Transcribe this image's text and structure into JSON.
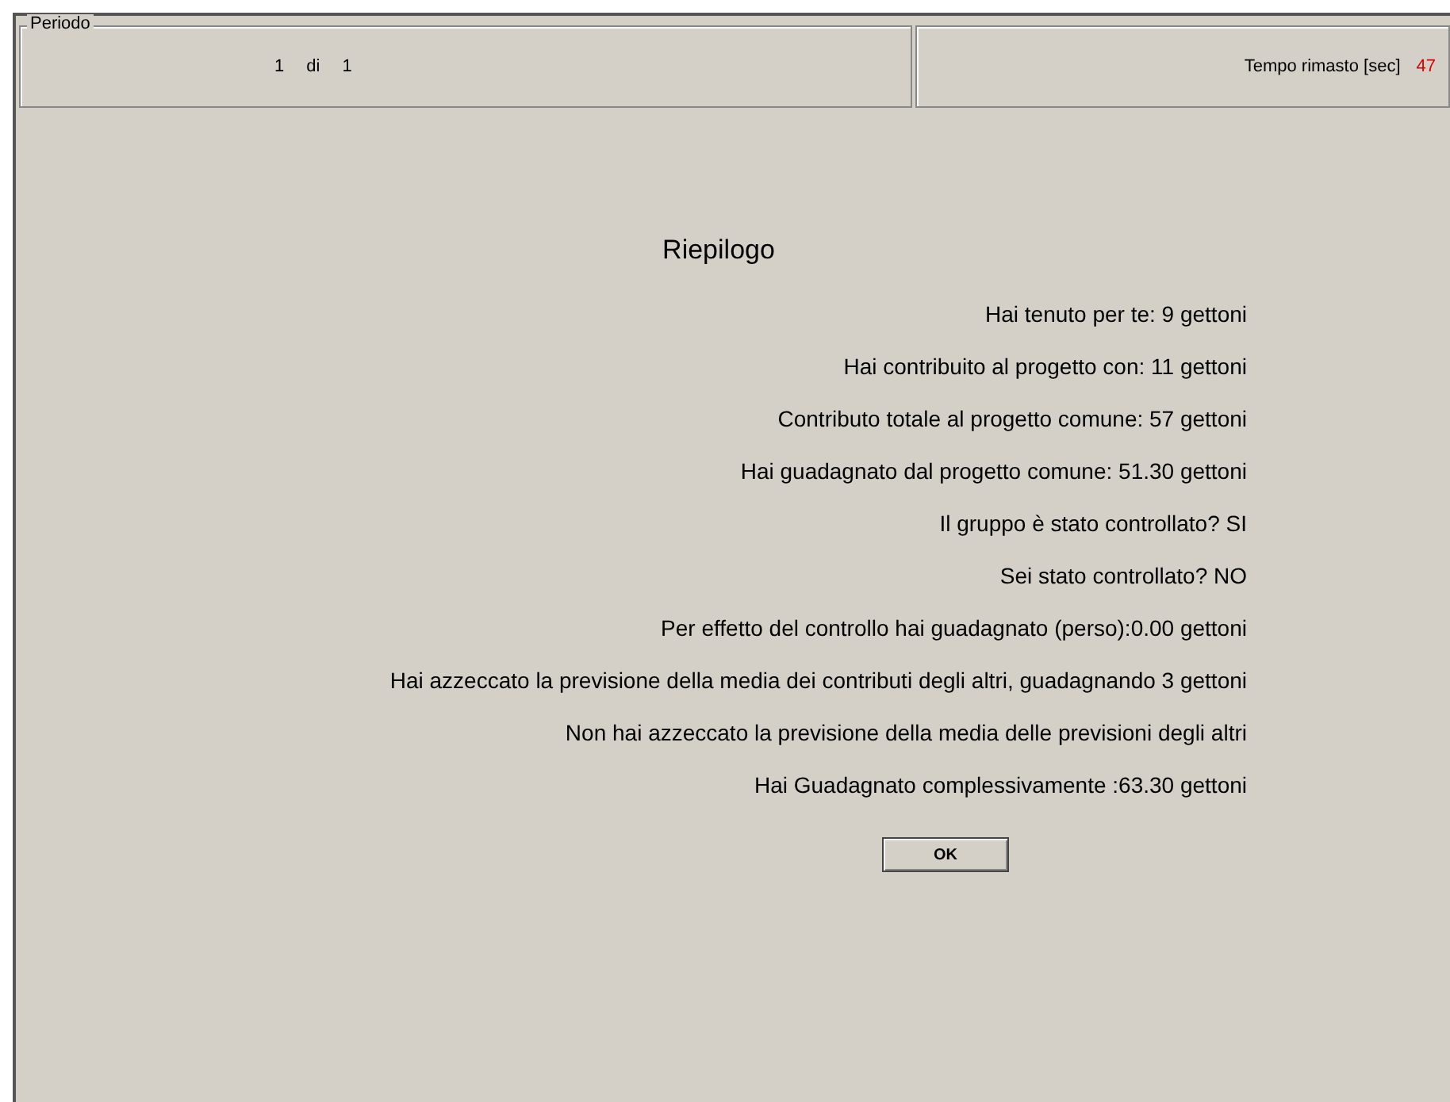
{
  "period_panel": {
    "legend": "Periodo",
    "current": "1",
    "separator": "di",
    "total": "1"
  },
  "timer_panel": {
    "label": "Tempo rimasto [sec]",
    "value": "47"
  },
  "summary": {
    "title": "Riepilogo",
    "lines": [
      "Hai tenuto per te: 9 gettoni",
      "Hai contribuito al progetto con: 11 gettoni",
      "Contributo totale al progetto comune: 57 gettoni",
      "Hai guadagnato dal progetto comune: 51.30 gettoni",
      "Il gruppo è stato controllato? SI",
      "Sei stato controllato? NO",
      "Per effetto del controllo hai guadagnato (perso):0.00 gettoni",
      "Hai azzeccato la previsione della media dei contributi degli altri, guadagnando 3 gettoni",
      "Non hai azzeccato la previsione della media delle previsioni degli altri",
      "Hai Guadagnato complessivamente :63.30 gettoni"
    ]
  },
  "buttons": [
    "OK"
  ]
}
